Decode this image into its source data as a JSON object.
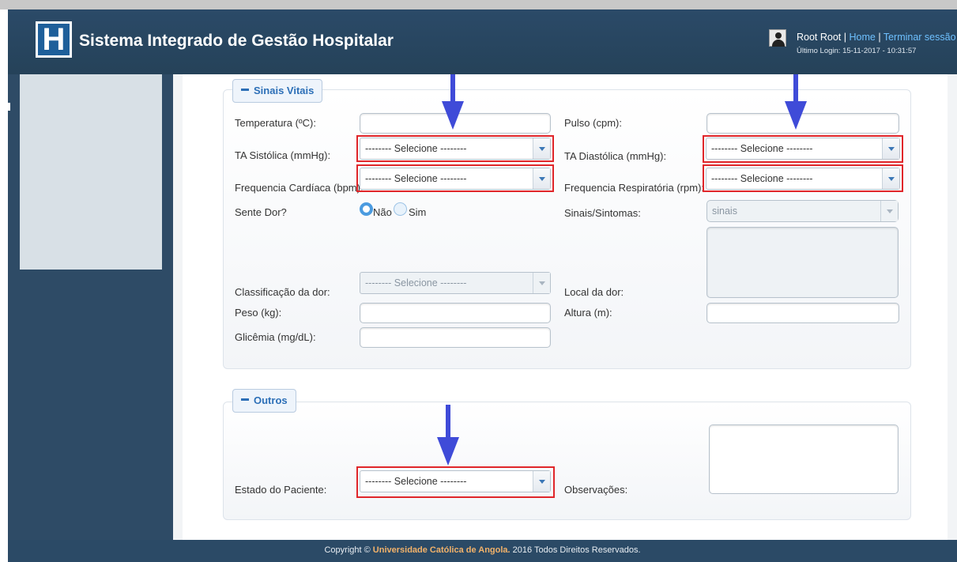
{
  "header": {
    "logo_letter": "H",
    "title": "Sistema Integrado de Gestão Hospitalar",
    "user_name": "Root Root",
    "separator": "|",
    "home_link": "Home",
    "logout_link": "Terminar sessão",
    "last_login": "Último Login: 15-11-2017 - 10:31:57"
  },
  "sinais_vitais": {
    "legend": "Sinais Vitais",
    "temperatura_label": "Temperatura (ºC):",
    "temperatura_value": "",
    "pulso_label": "Pulso (cpm):",
    "pulso_value": "",
    "ta_sistolica_label": "TA Sistólica (mmHg):",
    "ta_sistolica_value": "-------- Selecione --------",
    "ta_diastolica_label": "TA Diastólica (mmHg):",
    "ta_diastolica_value": "-------- Selecione --------",
    "freq_cardiaca_label": "Frequencia Cardíaca (bpm):",
    "freq_cardiaca_value": "-------- Selecione --------",
    "freq_respiratoria_label": "Frequencia Respiratória (rpm):",
    "freq_respiratoria_value": "-------- Selecione --------",
    "sente_dor_label": "Sente Dor?",
    "opt_nao": "Não",
    "opt_sim": "Sim",
    "sente_dor_selected": "Não",
    "sinais_sintomas_label": "Sinais/Sintomas:",
    "sinais_sintomas_value": "sinais",
    "classificacao_label": "Classificação da dor:",
    "classificacao_value": "-------- Selecione --------",
    "local_dor_label": "Local da dor:",
    "peso_label": "Peso (kg):",
    "peso_value": "",
    "altura_label": "Altura (m):",
    "altura_value": "",
    "glicemia_label": "Glicêmia (mg/dL):",
    "glicemia_value": ""
  },
  "outros": {
    "legend": "Outros",
    "estado_label": "Estado do Paciente:",
    "estado_value": "-------- Selecione --------",
    "observacoes_label": "Observações:",
    "observacoes_value": ""
  },
  "footer": {
    "prefix": "Copyright ©",
    "org": "Universidade Católica de Angola.",
    "suffix": "2016 Todos Direitos Reservados."
  },
  "colors": {
    "header_bg": "#2b4a68",
    "accent": "#2c6fb7",
    "highlight_box": "#e0262a",
    "arrow": "#3f4bd8",
    "footer_org": "#f2b26a"
  }
}
